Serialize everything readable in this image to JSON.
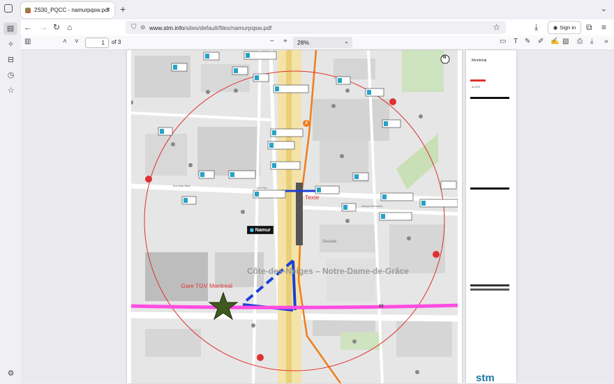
{
  "browser": {
    "tab_title": "2S30_PQCC - namurpqsw.pdf",
    "url_domain": "www.stm.info",
    "url_path": "/sites/default/files/namurpqsw.pdf",
    "signin_label": "Sign in"
  },
  "pdf_toolbar": {
    "page_current": "1",
    "page_count": "of 3",
    "zoom": "28%"
  },
  "map": {
    "area_name": "Côte-des-Neiges – Notre-Dame-de-Grâce",
    "station_label": "Namur",
    "annotation_texte": "Texte",
    "annotation_gare": "Gare TGV Montreal",
    "area_small": "Savane",
    "route_badge": "2",
    "hwy_badge": "15",
    "street_1": "Rue Jean-Talon",
    "street_2": "Avenue Plamondon",
    "street_3": "Rue Paré",
    "street_4": "Décarie",
    "bus_boxes": [
      "115",
      "161 165 171 372",
      "119",
      "17 161 171 372",
      "115",
      "51",
      "17 161 171 372",
      "92 372",
      "171",
      "17 161 171 372",
      "17 161 171 372",
      "Ville-Marie",
      "17 161 171",
      "17 161 171 372",
      "92",
      "17 161 171 372",
      "92 372",
      "51",
      "17 161 171 372",
      "161 165 372",
      "92 161 165 372",
      "16",
      "92 161 171 372"
    ],
    "north_label": "N"
  },
  "legend_page": {
    "title": "Montréal",
    "section": "ACCÈS",
    "logo": "stm"
  },
  "colors": {
    "pink_line": "#ff4de1",
    "blue_line": "#1a3fd6",
    "orange_line": "#f07d1a",
    "red_circle": "#e03030",
    "star": "#3f5a1f"
  }
}
